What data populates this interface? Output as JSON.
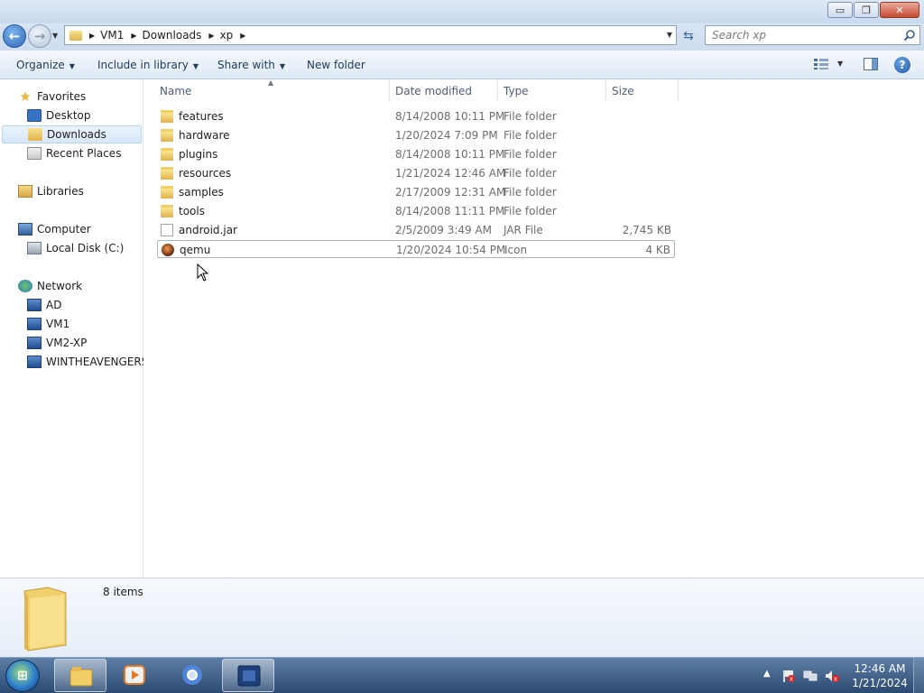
{
  "window": {
    "minimize_glyph": "▭",
    "maximize_glyph": "❐",
    "close_glyph": "✕"
  },
  "nav": {
    "back_glyph": "←",
    "forward_glyph": "→",
    "refresh_glyph": "⇆"
  },
  "address": {
    "crumbs": [
      "VM1",
      "Downloads",
      "xp"
    ]
  },
  "search": {
    "placeholder": "Search xp"
  },
  "toolbar": {
    "organize": "Organize",
    "include_in_library": "Include in library",
    "share_with": "Share with",
    "new_folder": "New folder",
    "help_glyph": "?"
  },
  "navpane": {
    "favorites": "Favorites",
    "desktop": "Desktop",
    "downloads": "Downloads",
    "recent_places": "Recent Places",
    "libraries": "Libraries",
    "computer": "Computer",
    "local_disk": "Local Disk (C:)",
    "network": "Network",
    "network_items": [
      "AD",
      "VM1",
      "VM2-XP",
      "WINTHEAVENGERS"
    ]
  },
  "columns": {
    "name": "Name",
    "date_modified": "Date modified",
    "type": "Type",
    "size": "Size"
  },
  "files": [
    {
      "name": "features",
      "date": "8/14/2008 10:11 PM",
      "type": "File folder",
      "size": "",
      "icon": "folder-icon"
    },
    {
      "name": "hardware",
      "date": "1/20/2024 7:09 PM",
      "type": "File folder",
      "size": "",
      "icon": "folder-icon"
    },
    {
      "name": "plugins",
      "date": "8/14/2008 10:11 PM",
      "type": "File folder",
      "size": "",
      "icon": "folder-icon"
    },
    {
      "name": "resources",
      "date": "1/21/2024 12:46 AM",
      "type": "File folder",
      "size": "",
      "icon": "folder-icon"
    },
    {
      "name": "samples",
      "date": "2/17/2009 12:31 AM",
      "type": "File folder",
      "size": "",
      "icon": "folder-icon"
    },
    {
      "name": "tools",
      "date": "8/14/2008 11:11 PM",
      "type": "File folder",
      "size": "",
      "icon": "folder-icon"
    },
    {
      "name": "android.jar",
      "date": "2/5/2009 3:49 AM",
      "type": "JAR File",
      "size": "2,745 KB",
      "icon": "file-icon"
    },
    {
      "name": "qemu",
      "date": "1/20/2024 10:54 PM",
      "type": "Icon",
      "size": "4 KB",
      "icon": "qemu-icon"
    }
  ],
  "details": {
    "item_count": "8 items"
  },
  "taskbar": {
    "start_glyph": "⊞",
    "time": "12:46 AM",
    "date": "1/21/2024"
  },
  "colors": {
    "accent": "#2a68b8",
    "selection": "#d6e8fb",
    "taskbar": "#2b4a72"
  }
}
